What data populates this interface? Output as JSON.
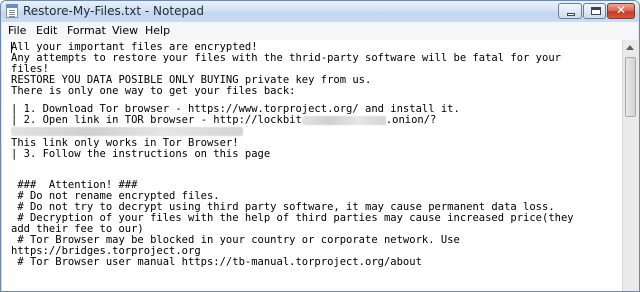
{
  "window": {
    "title": "Restore-My-Files.txt - Notepad",
    "close_glyph": "✕"
  },
  "menu": {
    "items": [
      "File",
      "Edit",
      "Format",
      "View",
      "Help"
    ]
  },
  "document": {
    "lines": [
      "All your important files are encrypted!",
      "Any attempts to restore your files with the thrid-party software will be fatal for your",
      "files!",
      "RESTORE YOU DATA POSIBLE ONLY BUYING private key from us.",
      "There is only one way to get your files back:",
      "",
      "| 1. Download Tor browser - https://www.torproject.org/ and install it.",
      "| 2. Open link in TOR browser - http://lockbit",
      ".onion/?",
      "This link only works in Tor Browser!",
      "| 3. Follow the instructions on this page",
      " ###  Attention! ###",
      " # Do not rename encrypted files.",
      " # Do not try to decrypt using third party software, it may cause permanent data loss.",
      " # Decryption of your files with the help of third parties may cause increased price(they",
      "add their fee to our)",
      " # Tor Browser may be blocked in your country or corporate network. Use",
      "https://bridges.torproject.org",
      " # Tor Browser user manual https://tb-manual.torproject.org/about"
    ]
  },
  "icons": {
    "app": "notepad-icon",
    "minimize": "minimize-icon",
    "maximize": "maximize-icon",
    "close": "close-icon"
  }
}
